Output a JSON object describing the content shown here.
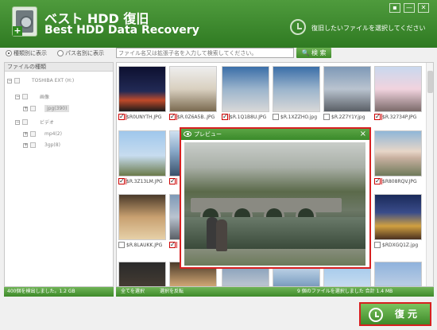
{
  "app": {
    "title_jp": "ベスト HDD 復旧",
    "title_en": "Best HDD Data Recovery",
    "header_hint": "復旧したいファイルを選択してください",
    "window_buttons": [
      "▪",
      "—",
      "✕"
    ]
  },
  "toolbar": {
    "radio_type": "種類別に表示",
    "radio_path": "パス名別に表示",
    "search_placeholder": "ファイル名又は拡張子名を入力して検索してください。",
    "search_button": "検 索"
  },
  "tree": {
    "header": "ファイルの種類",
    "items": [
      {
        "label": "TOSHIBA EXT (H:)",
        "exp": "−"
      },
      {
        "label": "画像",
        "exp": "−"
      },
      {
        "label": "jpg(390)",
        "exp": "+"
      },
      {
        "label": "ビデオ",
        "exp": "−"
      },
      {
        "label": "mp4(2)",
        "exp": "+"
      },
      {
        "label": "3gp(8)",
        "exp": "+"
      }
    ]
  },
  "grid": {
    "files": [
      {
        "name": "$R0UNYTH.JPG",
        "checked": true,
        "style": "t-night"
      },
      {
        "name": "$R.0Z6A5B..JPG",
        "checked": true,
        "style": "t-arch"
      },
      {
        "name": "$R.1Q1B8U.JPG",
        "checked": true,
        "style": "t-astro"
      },
      {
        "name": "$R.1XZZHO.jpg",
        "checked": false,
        "style": "t-astro"
      },
      {
        "name": "$R.2Z7Y1Y.jpg",
        "checked": false,
        "style": "t-city"
      },
      {
        "name": "$R.32734P.JPG",
        "checked": true,
        "style": "t-cherry"
      },
      {
        "name": "$R.3Z13LM.JPG",
        "checked": true,
        "style": "t-bldg"
      },
      {
        "name": "$R808RQV.JPG",
        "checked": true,
        "style": "t-tree"
      },
      {
        "name": "$R.8LAUKK.JPG",
        "checked": false,
        "style": "t-shop"
      },
      {
        "name": "$RDXGQ1Z.jpg",
        "checked": false,
        "style": "t-church"
      }
    ]
  },
  "preview": {
    "title": "プレビュー",
    "close": "×"
  },
  "status": {
    "found": "400個を検出しました。1.2 GB",
    "select_all": "全てを選択",
    "invert": "選択を反転",
    "selected": "9 個のファイルを選択しました 合計 1.4 MB"
  },
  "restore": {
    "label": "復 元"
  }
}
